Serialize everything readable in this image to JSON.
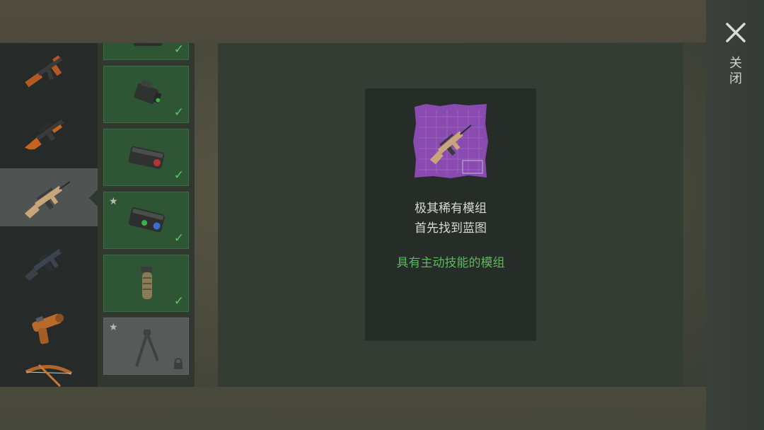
{
  "close": {
    "label": "关闭",
    "icon": "close-icon"
  },
  "weapons": [
    {
      "name": "ak-rifle-icon"
    },
    {
      "name": "sniper-rifle-icon"
    },
    {
      "name": "scar-rifle-icon",
      "selected": true
    },
    {
      "name": "m4-rifle-icon"
    },
    {
      "name": "flare-gun-icon"
    },
    {
      "name": "bow-icon"
    }
  ],
  "mods": [
    {
      "icon": "scope-mod-icon",
      "owned": true
    },
    {
      "icon": "laser-sight-icon",
      "owned": true
    },
    {
      "icon": "flashlight-mod-icon",
      "owned": true
    },
    {
      "icon": "night-vision-mod-icon",
      "owned": true,
      "starred": true
    },
    {
      "icon": "vertical-grip-icon",
      "owned": true
    },
    {
      "icon": "bipod-icon",
      "owned": false,
      "starred": true,
      "locked": true
    }
  ],
  "detail": {
    "icon": "blueprint-scar-icon",
    "line1": "极其稀有模组",
    "line2": "首先找到蓝图",
    "skill": "具有主动技能的模组"
  },
  "colors": {
    "accent_green": "#5cb85f",
    "owned_card": "#2e5534",
    "blueprint_purple": "#8a4bb0"
  }
}
